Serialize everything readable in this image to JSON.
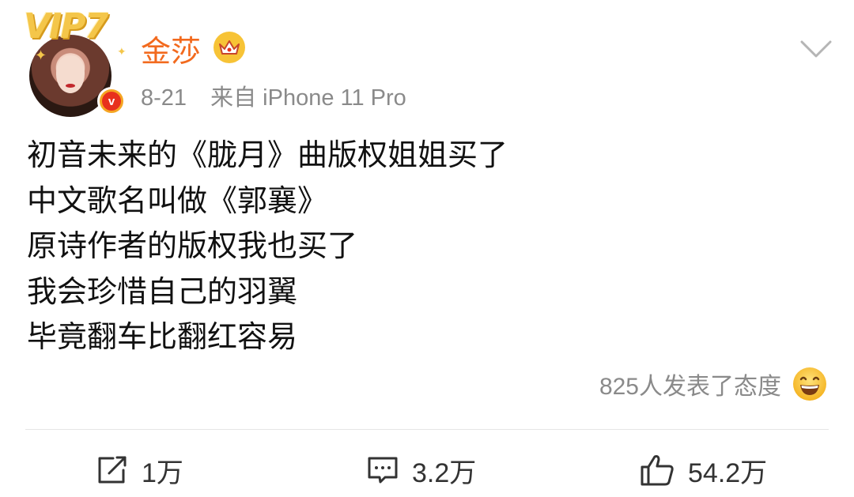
{
  "post": {
    "author": {
      "name": "金莎",
      "vip_badge": "VIP7",
      "verified_mark": "v",
      "crown_icon": "crown-icon",
      "avatar_icon": "avatar-photo"
    },
    "date": "8-21",
    "source": "来自 iPhone 11 Pro",
    "content_lines": [
      "初音未来的《胧月》曲版权姐姐买了",
      "中文歌名叫做《郭襄》",
      "原诗作者的版权我也买了",
      "我会珍惜自己的羽翼",
      "毕竟翻车比翻红容易"
    ],
    "reactions_text": "825人发表了态度",
    "reaction_icon": "grinning-emoji-icon"
  },
  "actions": {
    "repost": {
      "count": "1万",
      "icon": "repost-icon"
    },
    "comment": {
      "count": "3.2万",
      "icon": "comment-icon"
    },
    "like": {
      "count": "54.2万",
      "icon": "like-icon"
    }
  },
  "colors": {
    "username": "#f26a1e",
    "meta_text": "#8a8a8a",
    "vip_gold": "#f4c64a",
    "verified_orange": "#f5a623",
    "divider": "#e6e6e6"
  }
}
